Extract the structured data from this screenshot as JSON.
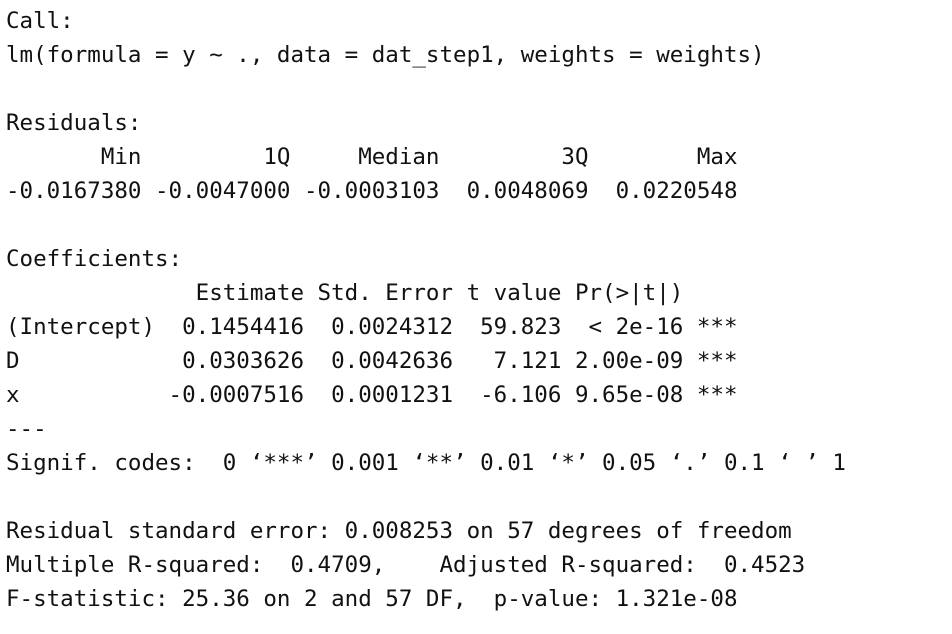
{
  "output": {
    "call_header": "Call:",
    "call_formula": "lm(formula = y ~ ., data = dat_step1, weights = weights)",
    "residuals_header": "Residuals:",
    "residuals_labels": "       Min         1Q     Median         3Q        Max ",
    "residuals_values": "-0.0167380 -0.0047000 -0.0003103  0.0048069  0.0220548 ",
    "coef_header": "Coefficients:",
    "coef_columns": "              Estimate Std. Error t value Pr(>|t|)    ",
    "coef_rows": [
      "(Intercept)  0.1454416  0.0024312  59.823  < 2e-16 ***",
      "D            0.0303626  0.0042636   7.121 2.00e-09 ***",
      "x           -0.0007516  0.0001231  -6.106 9.65e-08 ***"
    ],
    "separator": "---",
    "signif_codes": "Signif. codes:  0 ‘***’ 0.001 ‘**’ 0.01 ‘*’ 0.05 ‘.’ 0.1 ‘ ’ 1",
    "residual_se": "Residual standard error: 0.008253 on 57 degrees of freedom",
    "r_squared": "Multiple R-squared:  0.4709,    Adjusted R-squared:  0.4523 ",
    "f_statistic": "F-statistic: 25.36 on 2 and 57 DF,  p-value: 1.321e-08"
  }
}
